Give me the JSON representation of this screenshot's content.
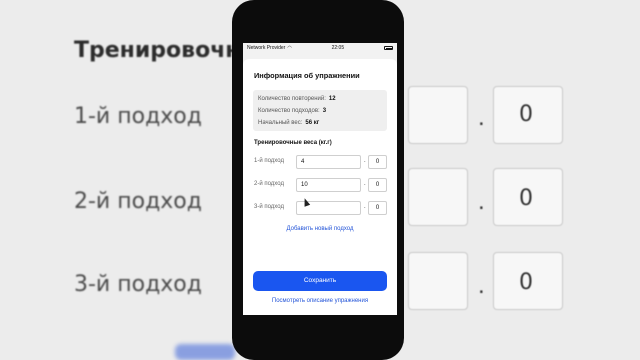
{
  "background": {
    "title": "Тренировочны",
    "rows": [
      {
        "label": "1-й подход",
        "decimal": "0"
      },
      {
        "label": "2-й подход",
        "decimal": "0"
      },
      {
        "label": "3-й подход",
        "decimal": "0"
      }
    ],
    "separator": "."
  },
  "statusbar": {
    "carrier": "Network Provider",
    "time": "22:05"
  },
  "sheet": {
    "title": "Информация об упражнении",
    "info": {
      "reps_label": "Количество повторений:",
      "reps_value": "12",
      "sets_label": "Количество подходов:",
      "sets_value": "3",
      "start_weight_label": "Начальный вес:",
      "start_weight_value": "56 кг"
    },
    "weights_title": "Тренировочные веса (кг.г)",
    "sets": [
      {
        "label": "1-й подход",
        "kg": "4",
        "g": "0"
      },
      {
        "label": "2-й подход",
        "kg": "10",
        "g": "0"
      },
      {
        "label": "3-й подход",
        "kg": "",
        "g": "0"
      }
    ],
    "separator": ".",
    "add_set_label": "Добавить новый подход",
    "save_label": "Сохранить",
    "view_description_label": "Посмотреть описание упражнения"
  },
  "colors": {
    "accent": "#1a56f0",
    "link": "#2455d8"
  }
}
